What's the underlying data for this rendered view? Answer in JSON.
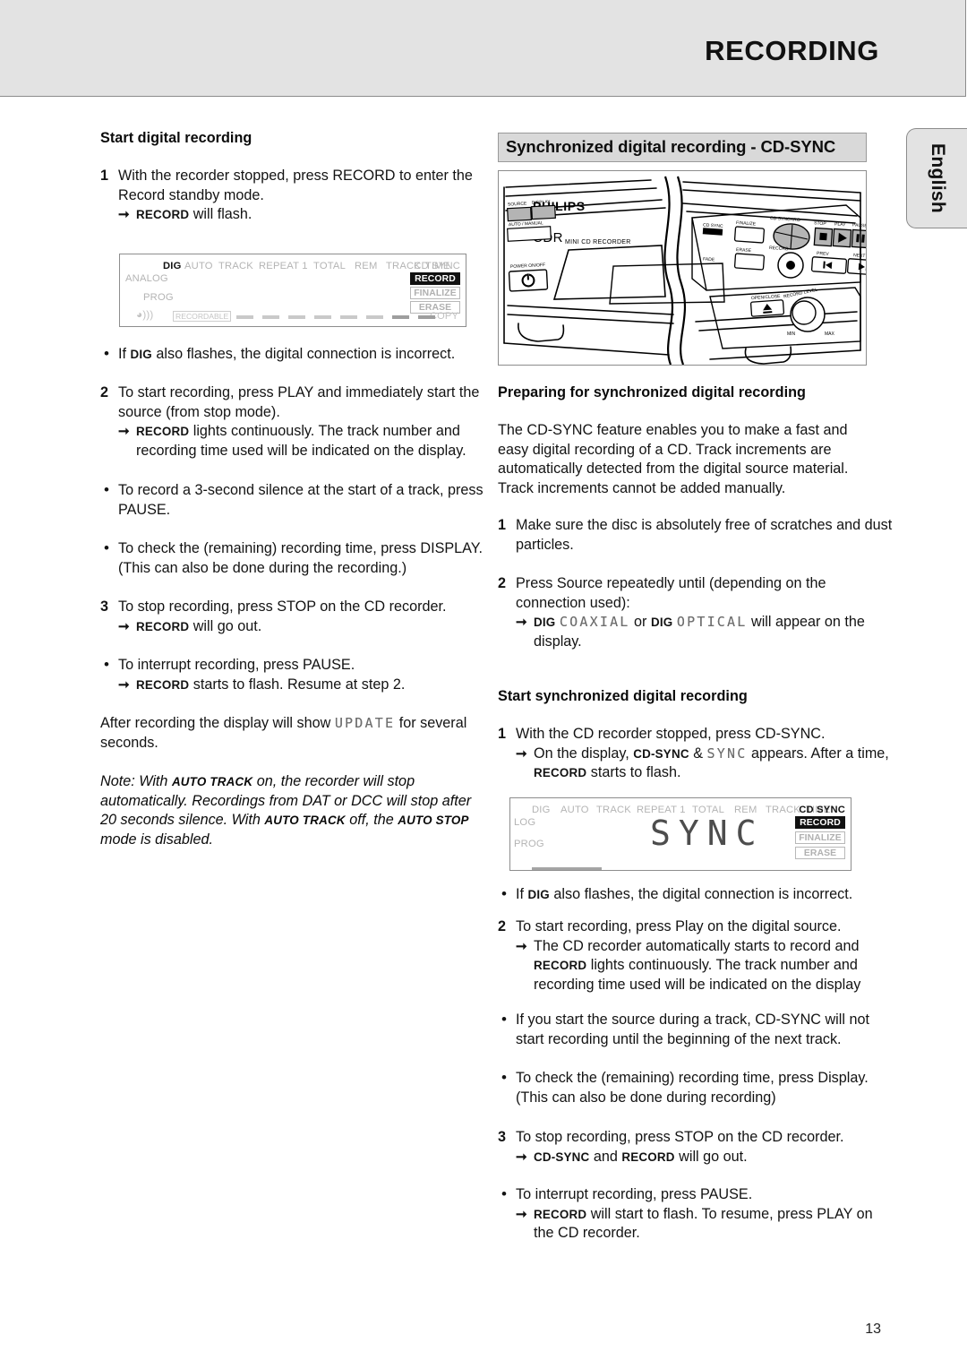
{
  "header": {
    "title": "RECORDING"
  },
  "lang_tab": {
    "label": "English"
  },
  "page_number": "13",
  "left_column": {
    "heading": "Start digital recording",
    "step1": {
      "num": "1",
      "text": "With the recorder stopped, press RECORD to enter the Record standby mode.",
      "arrow_label": "RECORD",
      "arrow_text": "will flash."
    },
    "bullet_dig": {
      "pre": "If",
      "label": "DIG",
      "post": "also flashes, the digital connection is incorrect."
    },
    "step2": {
      "num": "2",
      "text": "To start recording, press PLAY and immediately start the source (from stop mode).",
      "arrow_label": "RECORD",
      "arrow_text": "lights continuously. The track number and recording time used will be indicated on the display."
    },
    "bullet_silence": "To record a 3-second silence at the start of a track, press PAUSE.",
    "bullet_display": "To check the (remaining) recording time, press DISPLAY. (This can also be done during the recording.)",
    "step3": {
      "num": "3",
      "text": "To stop recording, press STOP on the CD recorder.",
      "arrow_label": "RECORD",
      "arrow_text": "will go out."
    },
    "bullet_interrupt": "To interrupt recording, press PAUSE.",
    "bullet_interrupt_arrow_label": "RECORD",
    "bullet_interrupt_arrow_text": "starts to flash. Resume at step 2.",
    "after_recording_pre": "After recording the display will show",
    "after_recording_lcd": "UPDATE",
    "after_recording_post": "for several seconds.",
    "note": {
      "prefix": "Note:",
      "part1": "With",
      "label1": "AUTO TRACK",
      "part2": "on, the recorder will stop automatically. Recordings from DAT or DCC will stop after 20 seconds silence. With",
      "label2": "AUTO TRACK",
      "part3": "off, the",
      "label3": "AUTO STOP",
      "part4": "mode is disabled."
    }
  },
  "right_column": {
    "bar_heading": "Synchronized digital recording - CD-SYNC",
    "device": {
      "brand": "PHILIPS",
      "model": "CDR",
      "model_sub": "MINI CD RECORDER",
      "buttons": [
        "SOURCE",
        "DISPLAY",
        "AUTO / MANUAL",
        "POWER ON/OFF",
        "CD SYNC",
        "FINALIZE",
        "CD SYNCHRO",
        "STOP",
        "PLAY",
        "PAUSE",
        "FADE",
        "ERASE",
        "RECORD",
        "PREV",
        "NEXT",
        "OPEN/CLOSE",
        "RECORD LEVEL",
        "MIN",
        "MAX"
      ]
    },
    "prep_heading": "Preparing for synchronized digital recording",
    "prep_para": "The CD-SYNC feature enables you to make a fast and easy digital recording of a CD. Track increments are automatically detected from the digital source material. Track increments cannot be added manually.",
    "prep_step1": {
      "num": "1",
      "text": "Make sure the disc is absolutely free of scratches and dust particles."
    },
    "prep_step2": {
      "num": "2",
      "text": "Press Source repeatedly until (depending on the connection used):",
      "arrow_dig1": "DIG",
      "arrow_lcd1": "COAXIAL",
      "arrow_or": "or",
      "arrow_dig2": "DIG",
      "arrow_lcd2": "OPTICAL",
      "arrow_tail": "will appear on the display."
    },
    "start_heading": "Start synchronized digital recording",
    "start_step1": {
      "num": "1",
      "text": "With the CD recorder stopped, press CD-SYNC.",
      "arrow_pre": "On the display,",
      "arrow_label": "CD-SYNC",
      "arrow_amp": "&",
      "arrow_lcd": "SYNC",
      "arrow_mid": "appears. After a time,",
      "arrow_label2": "RECORD",
      "arrow_post": "starts to flash."
    },
    "bullet_dig": {
      "pre": "If",
      "label": "DIG",
      "post": "also flashes, the digital connection is incorrect."
    },
    "start_step2": {
      "num": "2",
      "text": "To start recording, press Play on the digital source.",
      "arrow_pre": "The CD recorder automatically starts to record and",
      "arrow_label": "RECORD",
      "arrow_post": "lights continuously. The track number and recording time used will be indicated on the display"
    },
    "bullet_source_track": "If you start the source during a track, CD-SYNC will not start recording until the beginning of the next track.",
    "bullet_check_time": "To check the (remaining) recording time, press Display. (This can also be done during recording)",
    "start_step3": {
      "num": "3",
      "text": "To stop recording, press STOP on the CD recorder.",
      "arrow_label1": "CD-SYNC",
      "arrow_and": "and",
      "arrow_label2": "RECORD",
      "arrow_post": "will go out."
    },
    "bullet_interrupt": "To interrupt recording, press PAUSE.",
    "bullet_interrupt_arrow_label": "RECORD",
    "bullet_interrupt_arrow_text": "will start to flash. To resume, press PLAY on the CD recorder."
  },
  "lcd_display_1": {
    "top_segments": [
      "DIG",
      "AUTO",
      "TRACK",
      "REPEAT 1",
      "TOTAL",
      "REM",
      "TRACK",
      "TIME",
      "CD SYNC"
    ],
    "active_top": [
      "DIG"
    ],
    "left_labels": [
      "ANALOG",
      "PROG"
    ],
    "right_boxes": [
      {
        "label": "RECORD",
        "state": "invert"
      },
      {
        "label": "FINALIZE",
        "state": "outline"
      },
      {
        "label": "ERASE",
        "state": "outline"
      }
    ],
    "bottom_left": "RECORDABLE",
    "bottom_right": "COPY",
    "main_text": ""
  },
  "lcd_display_2": {
    "top_segments": [
      "DIG",
      "AUTO",
      "TRACK",
      "REPEAT 1",
      "TOTAL",
      "REM",
      "TRACK",
      "TIME",
      "CD SYNC"
    ],
    "active_top": [
      "CD SYNC"
    ],
    "left_labels": [
      "LOG",
      "PROG"
    ],
    "right_boxes": [
      {
        "label": "RECORD",
        "state": "invert"
      },
      {
        "label": "FINALIZE",
        "state": "outline"
      },
      {
        "label": "ERASE",
        "state": "outline"
      }
    ],
    "main_text": "SYNC"
  },
  "colors": {
    "header_band": "#e3e3e3",
    "bar_heading": "#d9d9d9",
    "text": "#131313",
    "lcd_dim": "#b4b4b4"
  }
}
